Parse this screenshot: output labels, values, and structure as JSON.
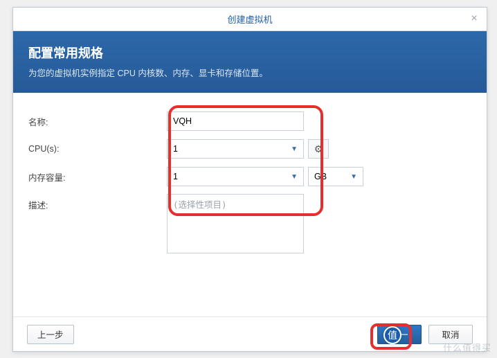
{
  "dialog": {
    "title": "创建虚拟机",
    "close_glyph": "×"
  },
  "header": {
    "title": "配置常用规格",
    "subtitle": "为您的虚拟机实例指定 CPU 内核数、内存、显卡和存储位置。"
  },
  "form": {
    "name_label": "名称:",
    "name_value": "VQH",
    "cpu_label": "CPU(s):",
    "cpu_value": "1",
    "memory_label": "内存容量:",
    "memory_value": "1",
    "memory_unit": "GB",
    "desc_label": "描述:",
    "desc_placeholder": "(选择性项目)"
  },
  "icons": {
    "gear": "⚙",
    "caret": "▼"
  },
  "buttons": {
    "prev": "上一步",
    "next": "下一",
    "cancel": "取消"
  },
  "watermark": {
    "text": "什么值得买",
    "badge": "值"
  }
}
